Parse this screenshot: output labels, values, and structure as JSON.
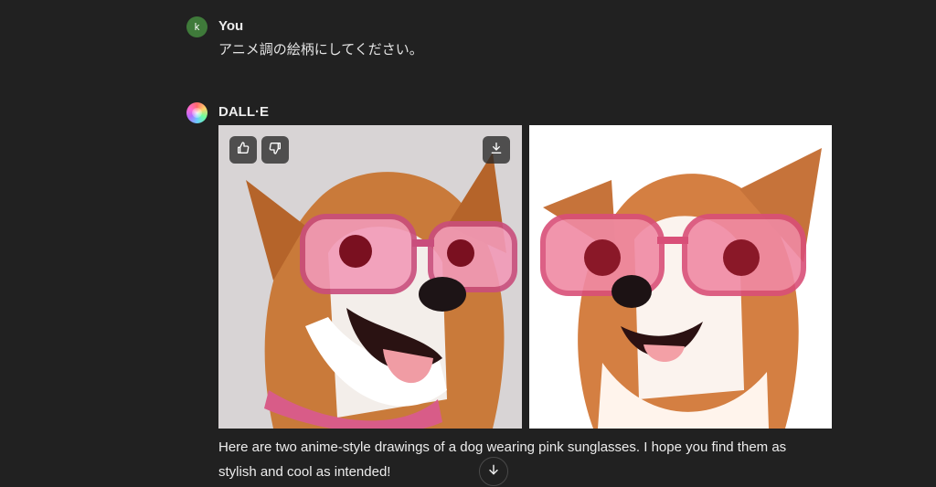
{
  "messages": [
    {
      "author": "You",
      "avatar_letter": "k",
      "text": "アニメ調の絵柄にしてください。"
    },
    {
      "author": "DALL·E",
      "text": "Here are two anime-style drawings of a dog wearing pink sunglasses. I hope you find them as stylish and cool as intended!"
    }
  ],
  "icons": [
    "thumbs-up-icon",
    "thumbs-down-icon",
    "download-icon",
    "arrow-down-icon"
  ],
  "colors": {
    "background": "#212121",
    "text": "#ececec",
    "user_avatar": "#3f7a3a"
  }
}
